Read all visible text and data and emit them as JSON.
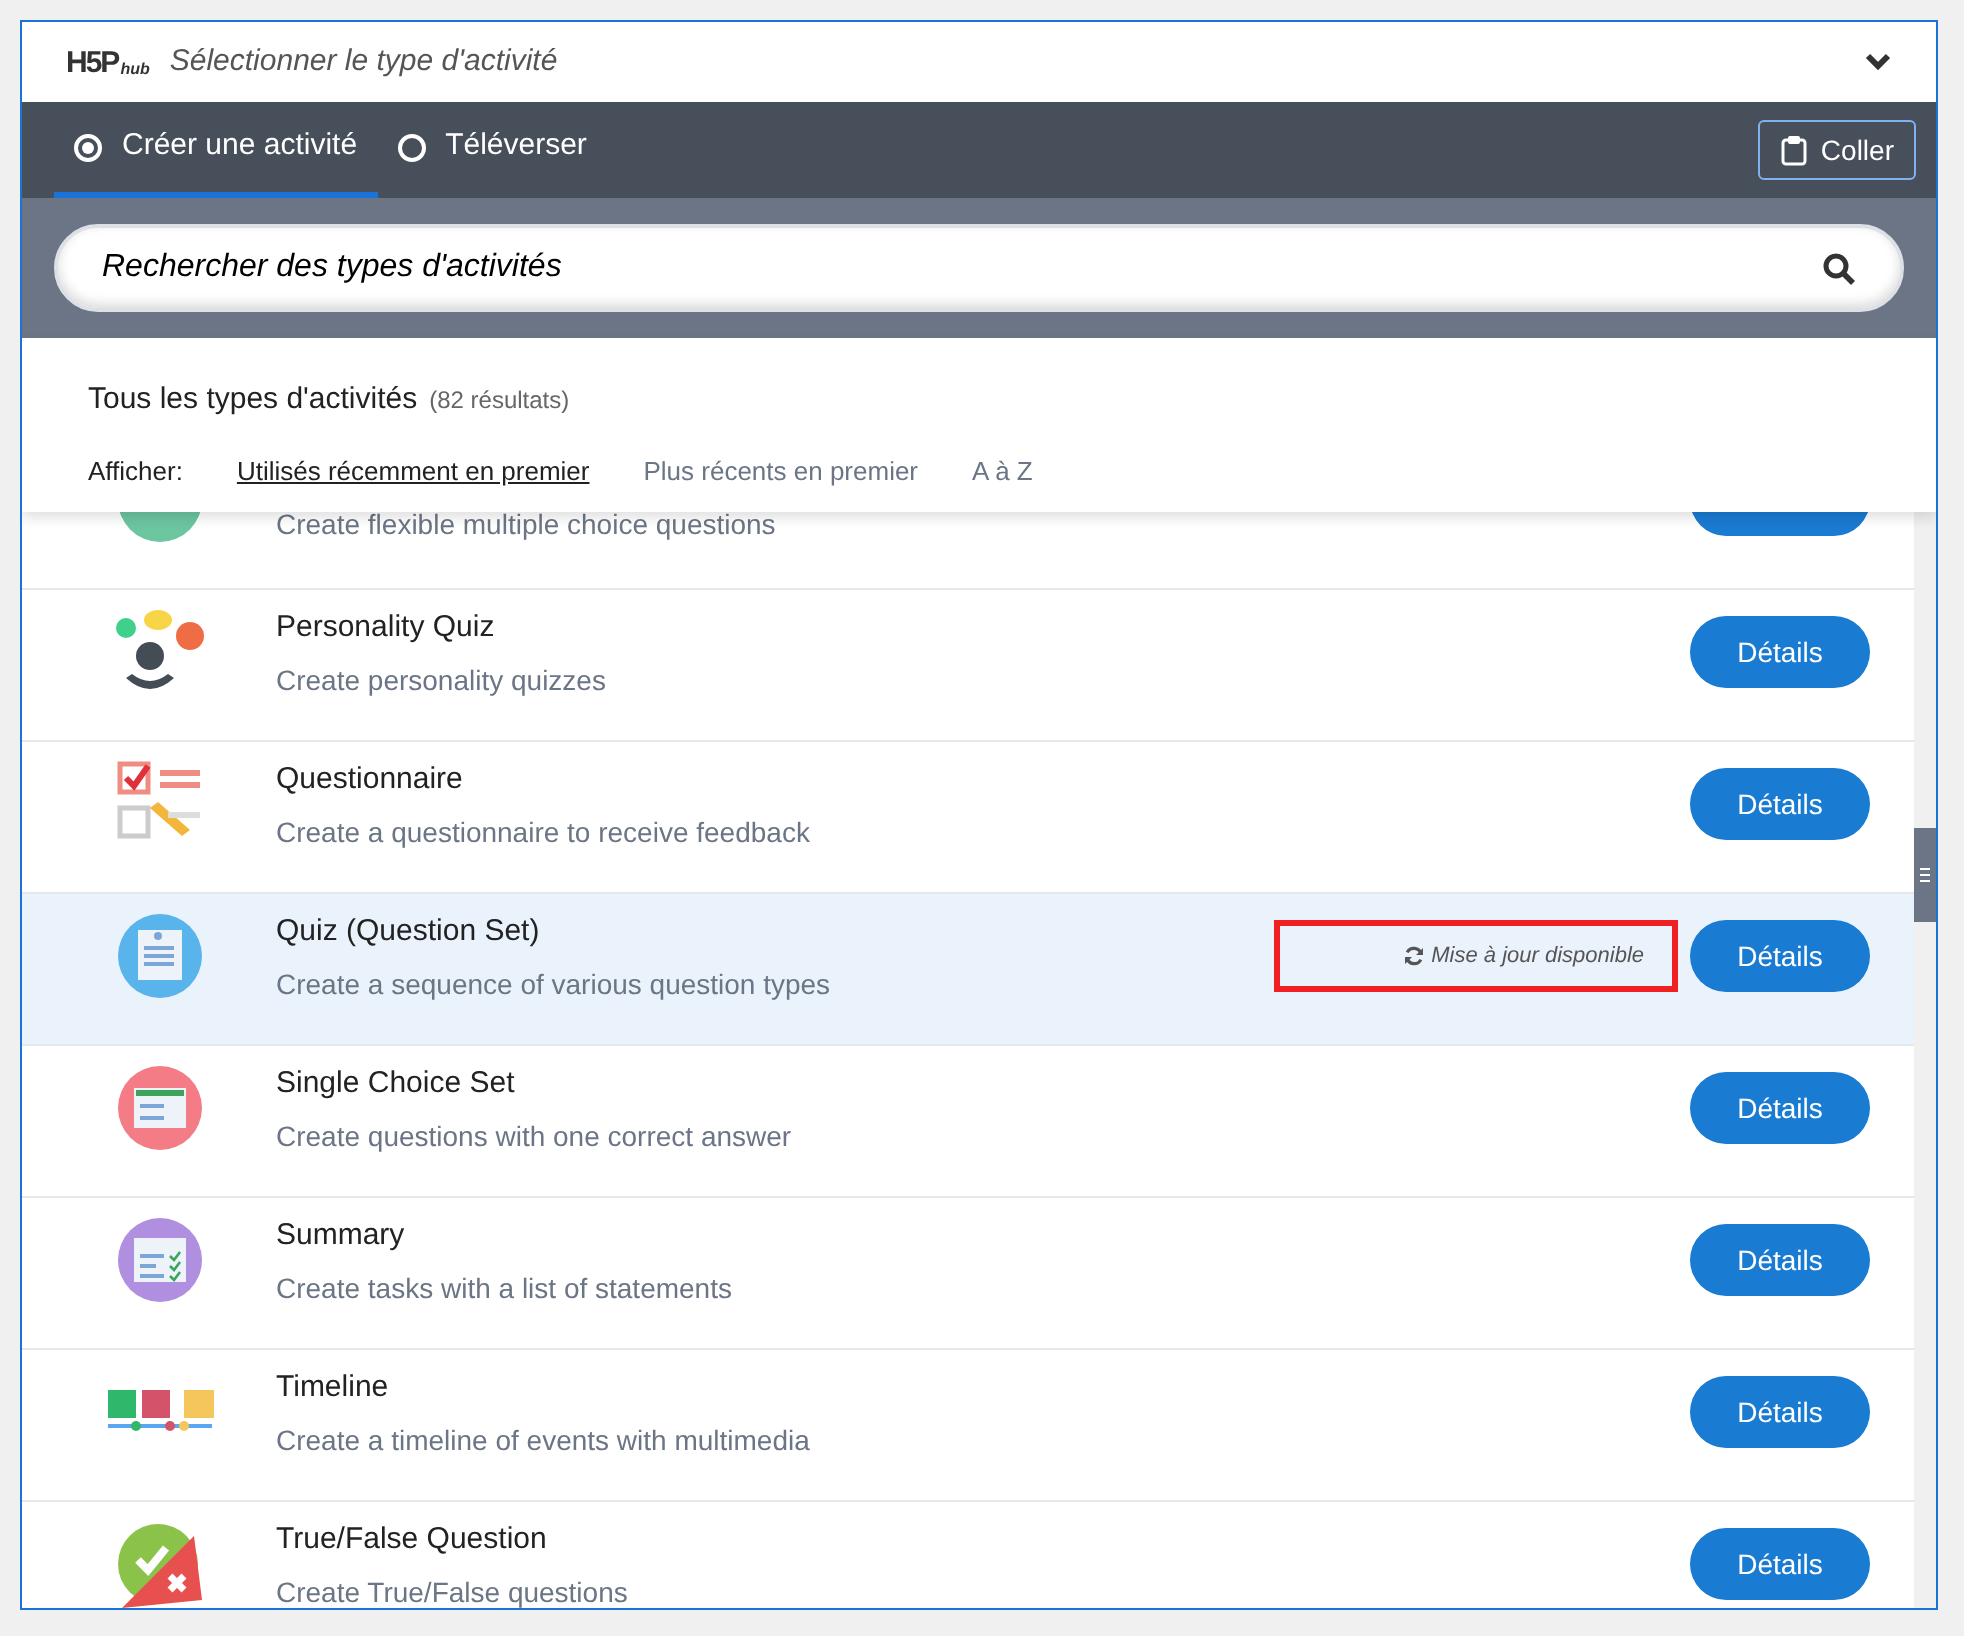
{
  "header": {
    "logo": "H5P",
    "logo_sub": "hub",
    "title": "Sélectionner le type d'activité"
  },
  "tabs": [
    {
      "label": "Créer une activité",
      "selected": true
    },
    {
      "label": "Téléverser",
      "selected": false
    }
  ],
  "paste_button": "Coller",
  "search": {
    "placeholder": "Rechercher des types d'activités"
  },
  "results": {
    "title": "Tous les types d'activités",
    "count": "(82 résultats)"
  },
  "sort": {
    "label": "Afficher:",
    "options": [
      {
        "label": "Utilisés récemment en premier",
        "selected": true
      },
      {
        "label": "Plus récents en premier",
        "selected": false
      },
      {
        "label": "A à Z",
        "selected": false
      }
    ]
  },
  "items": [
    {
      "description": "Create flexible multiple choice questions",
      "highlighted": false
    },
    {
      "title": "Personality Quiz",
      "description": "Create personality quizzes",
      "button": "Détails",
      "highlighted": false
    },
    {
      "title": "Questionnaire",
      "description": "Create a questionnaire to receive feedback",
      "button": "Détails",
      "highlighted": false
    },
    {
      "title": "Quiz (Question Set)",
      "description": "Create a sequence of various question types",
      "button": "Détails",
      "highlighted": true,
      "update": "Mise à jour disponible"
    },
    {
      "title": "Single Choice Set",
      "description": "Create questions with one correct answer",
      "button": "Détails",
      "highlighted": false
    },
    {
      "title": "Summary",
      "description": "Create tasks with a list of statements",
      "button": "Détails",
      "highlighted": false
    },
    {
      "title": "Timeline",
      "description": "Create a timeline of events with multimedia",
      "button": "Détails",
      "highlighted": false
    },
    {
      "title": "True/False Question",
      "description": "Create True/False questions",
      "button": "Détails",
      "highlighted": false
    }
  ]
}
